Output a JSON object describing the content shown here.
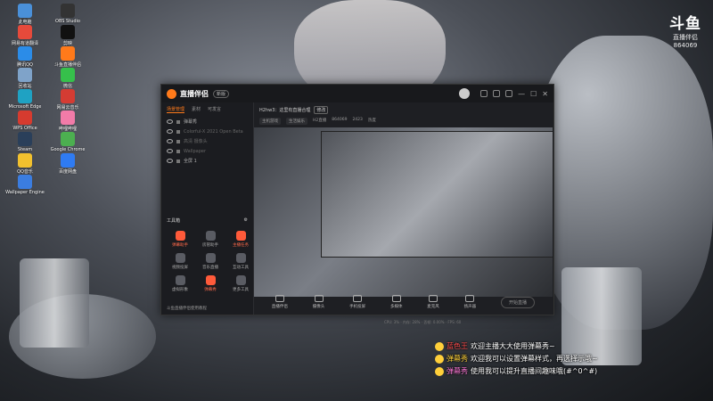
{
  "desktop": {
    "icons": [
      {
        "label": "此电脑",
        "color": "#4a90d9"
      },
      {
        "label": "网易有道翻译",
        "color": "#e64a3b"
      },
      {
        "label": "腾讯QQ",
        "color": "#2b8ce8"
      },
      {
        "label": "回收站",
        "color": "#7fa3c9"
      },
      {
        "label": "Microsoft Edge",
        "color": "#1fa2c3"
      },
      {
        "label": "WPS Office",
        "color": "#d63b2f"
      },
      {
        "label": "Steam",
        "color": "#2a3f5a"
      },
      {
        "label": "QQ音乐",
        "color": "#f2c12e"
      },
      {
        "label": "Wallpaper Engine",
        "color": "#3b7de0"
      },
      {
        "label": "OBS Studio",
        "color": "#333333"
      },
      {
        "label": "剪映",
        "color": "#111111"
      },
      {
        "label": "斗鱼直播伴侣",
        "color": "#ff7a1a"
      },
      {
        "label": "微信",
        "color": "#36c04b"
      },
      {
        "label": "网易云音乐",
        "color": "#d43c33"
      },
      {
        "label": "哔哩哔哩",
        "color": "#f27ba8"
      },
      {
        "label": "Google Chrome",
        "color": "#4caf50"
      },
      {
        "label": "百度网盘",
        "color": "#2f7bf2"
      }
    ]
  },
  "brand": {
    "mark": "斗鱼",
    "sub": "直播伴侣",
    "room_id": "864069"
  },
  "window": {
    "title": "直播伴侣",
    "version": "新版",
    "left_tabs": [
      "场景管理",
      "素材",
      "可发言"
    ],
    "scenes": [
      {
        "label": "弹幕秀",
        "dim": false
      },
      {
        "label": "Colorful-X 2021 Open Beta",
        "dim": true
      },
      {
        "label": "高清 摄像头",
        "dim": true
      },
      {
        "label": "Wallpaper",
        "dim": true
      },
      {
        "label": "全屏 1",
        "dim": false
      }
    ],
    "tools_title": "工具箱",
    "tools": [
      {
        "label": "弹幕助手",
        "hot": true
      },
      {
        "label": "房管助手",
        "hot": false
      },
      {
        "label": "主播任务",
        "hot": true
      },
      {
        "label": "视频投屏",
        "hot": false
      },
      {
        "label": "音乐直播",
        "hot": false
      },
      {
        "label": "互动工具",
        "hot": false
      },
      {
        "label": "虚拟形象",
        "hot": false
      },
      {
        "label": "弹幕秀",
        "hot": true
      },
      {
        "label": "更多工具",
        "hot": false
      }
    ],
    "live_tip": "斗鱼直播伴侣使用教程",
    "room": {
      "title": "H2hw3：这里有直播合理",
      "badge": "修改",
      "category": "主机游戏",
      "category2": "生活娱乐"
    },
    "stats": [
      "H2直播",
      "864069",
      "2423",
      "热度"
    ],
    "controls": [
      {
        "label": "直播伴侣"
      },
      {
        "label": "摄像头"
      },
      {
        "label": "手机投屏"
      },
      {
        "label": "多媒体"
      },
      {
        "label": "麦克风"
      },
      {
        "label": "扬声器"
      }
    ],
    "start_button": "开始直播",
    "status": "CPU: 3% · 内存: 28% · 丢帧: 0.00% · FPS: 60"
  },
  "danmaku": [
    {
      "user": "蓝色王",
      "user_color": "#ff4d4d",
      "msg": "欢迎主播大大使用弹幕秀~"
    },
    {
      "user": "弹幕秀",
      "user_color": "#ffd23a",
      "msg": "欢迎我可以设置弹幕样式，再选择示哦~"
    },
    {
      "user": "弹幕秀",
      "user_color": "#ff7ad9",
      "msg": "使用我可以提升直播间趣味哦(#^0^#)"
    }
  ]
}
